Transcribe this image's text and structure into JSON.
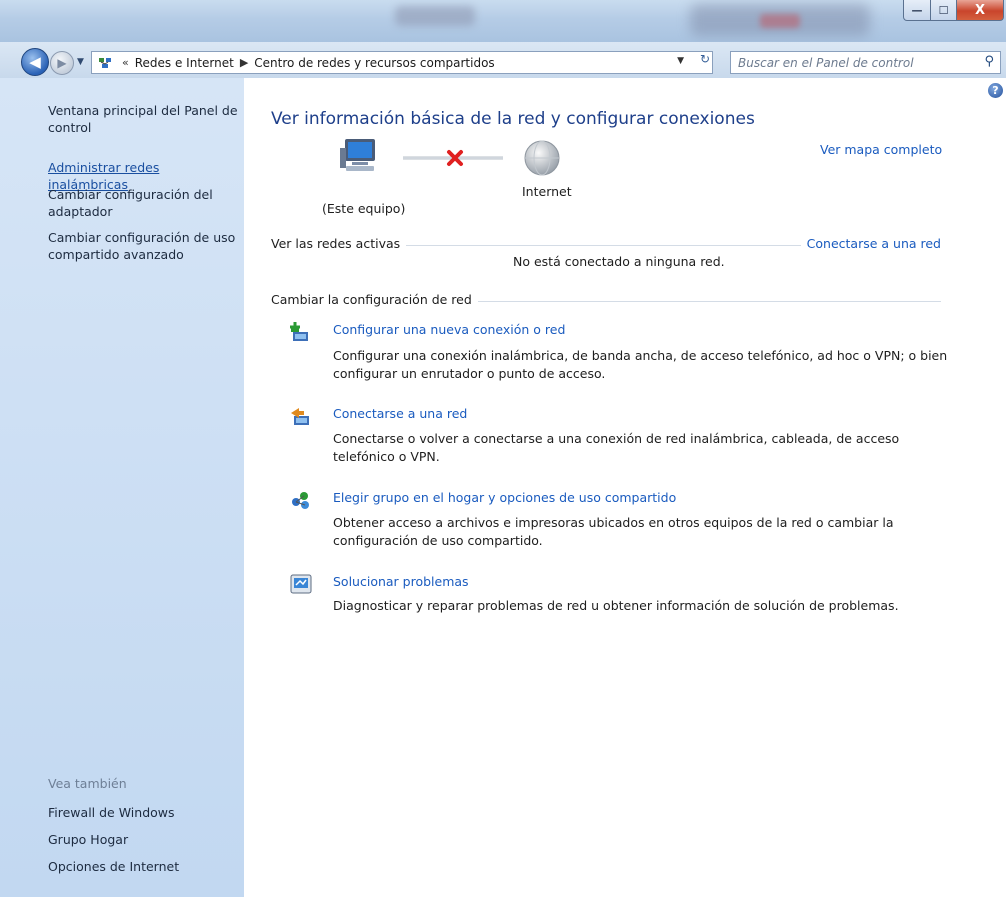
{
  "window": {
    "minimize_glyph": "—",
    "maximize_glyph": "☐",
    "close_glyph": "X"
  },
  "nav": {
    "back_glyph": "◀",
    "forward_glyph": "▶",
    "breadcrumb": [
      "Redes e Internet",
      "Centro de redes y recursos compartidos"
    ],
    "overflow_glyph": "«",
    "search_placeholder": "Buscar en el Panel de control"
  },
  "sidebar": {
    "items": [
      {
        "label": "Ventana principal del Panel de control"
      },
      {
        "label": "Administrar redes inalámbricas"
      },
      {
        "label": "Cambiar configuración del adaptador"
      },
      {
        "label": "Cambiar configuración de uso compartido avanzado"
      }
    ],
    "see_also_heading": "Vea también",
    "see_also": [
      {
        "label": "Firewall de Windows"
      },
      {
        "label": "Grupo Hogar"
      },
      {
        "label": "Opciones de Internet"
      }
    ]
  },
  "main": {
    "title": "Ver información básica de la red y configurar conexiones",
    "see_full_map": "Ver mapa completo",
    "computer_label": "(Este equipo)",
    "internet_label": "Internet",
    "active_networks_heading": "Ver las redes activas",
    "connect_link": "Conectarse a una red",
    "no_connection": "No está conectado a ninguna red.",
    "change_settings_heading": "Cambiar la configuración de red",
    "tasks": [
      {
        "title": "Configurar una nueva conexión o red",
        "description": "Configurar una conexión inalámbrica, de banda ancha, de acceso telefónico, ad hoc o VPN; o bien configurar un enrutador o punto de acceso."
      },
      {
        "title": "Conectarse a una red",
        "description": "Conectarse o volver a conectarse a una conexión de red inalámbrica, cableada, de acceso telefónico o VPN."
      },
      {
        "title": "Elegir grupo en el hogar y opciones de uso compartido",
        "description": "Obtener acceso a archivos e impresoras ubicados en otros equipos de la red o cambiar la configuración de uso compartido."
      },
      {
        "title": "Solucionar problemas",
        "description": "Diagnosticar y reparar problemas de red u obtener información de solución de problemas."
      }
    ]
  },
  "colors": {
    "link": "#1a5bbf",
    "title": "#1e3f8a",
    "sidebar_bg": "#cfe0f4",
    "error_x": "#e02020"
  }
}
